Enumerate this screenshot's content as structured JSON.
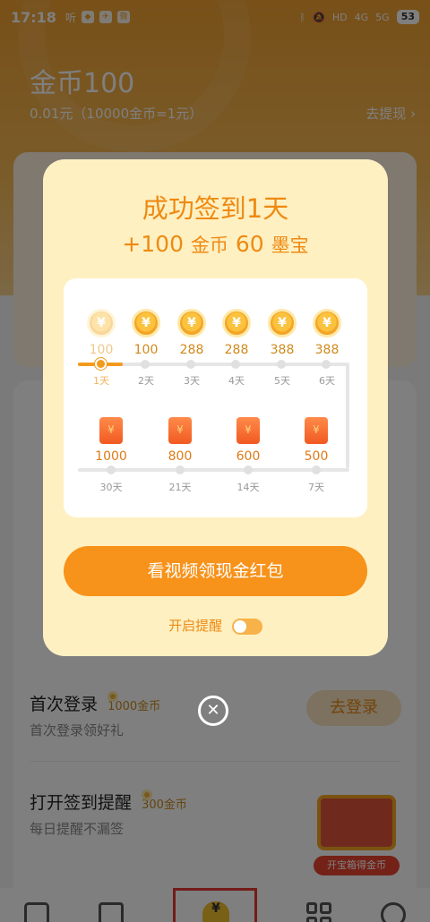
{
  "status_bar": {
    "time": "17:18",
    "left_icons": [
      "听",
      "◆",
      "✈",
      "微"
    ],
    "right_icons": [
      "bluetooth-icon",
      "mute-icon",
      "hd-icon",
      "4g-signal-icon",
      "5g-signal-icon"
    ],
    "net_4g": "4G",
    "net_5g": "5G",
    "hd": "HD",
    "battery": "53"
  },
  "header": {
    "coins_title": "金币100",
    "coins_sub": "0.01元（10000金币=1元）",
    "withdraw": "去提现 ›"
  },
  "tasks": [
    {
      "title": "首次登录",
      "reward": "1000金币",
      "desc": "首次登录领好礼",
      "button": "去登录"
    },
    {
      "title": "打开签到提醒",
      "reward": "300金币",
      "desc": "每日提醒不漏签"
    }
  ],
  "chest_label": "开宝箱得金币",
  "modal": {
    "title": "成功签到1天",
    "reward_plus": "+100",
    "reward_coin_label": "金币",
    "reward_num2": "60",
    "reward_item_label": "墨宝",
    "row1": [
      {
        "amount": "100",
        "day": "1天"
      },
      {
        "amount": "100",
        "day": "2天"
      },
      {
        "amount": "288",
        "day": "3天"
      },
      {
        "amount": "288",
        "day": "4天"
      },
      {
        "amount": "388",
        "day": "5天"
      },
      {
        "amount": "388",
        "day": "6天"
      }
    ],
    "row2": [
      {
        "amount": "1000",
        "day": "30天"
      },
      {
        "amount": "800",
        "day": "21天"
      },
      {
        "amount": "600",
        "day": "14天"
      },
      {
        "amount": "500",
        "day": "7天"
      }
    ],
    "coin_symbol": "¥",
    "cta": "看视频领现金红包",
    "remind_label": "开启提醒",
    "close_symbol": "✕"
  },
  "nav_symbol": "¥"
}
